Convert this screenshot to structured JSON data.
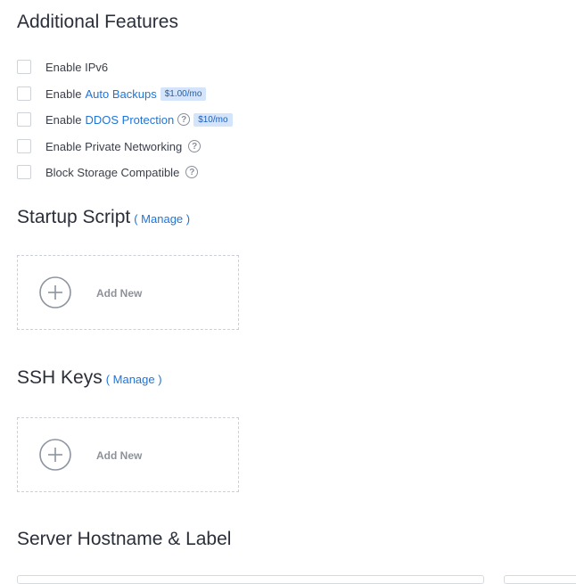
{
  "additional_features": {
    "title": "Additional Features",
    "items": [
      {
        "prefix": "Enable IPv6",
        "link": "",
        "price": "",
        "help": false
      },
      {
        "prefix": "Enable",
        "link": "Auto Backups",
        "price": "$1.00/mo",
        "help": false
      },
      {
        "prefix": "Enable",
        "link": "DDOS Protection",
        "price": "$10/mo",
        "help": true
      },
      {
        "prefix": "Enable Private Networking",
        "link": "",
        "price": "",
        "help": true
      },
      {
        "prefix": "Block Storage Compatible",
        "link": "",
        "price": "",
        "help": true
      }
    ]
  },
  "startup_script": {
    "title": "Startup Script",
    "manage_label": "( Manage )",
    "add_label": "Add New"
  },
  "ssh_keys": {
    "title": "SSH Keys",
    "manage_label": "( Manage )",
    "add_label": "Add New"
  },
  "server_hostname": {
    "title": "Server Hostname & Label"
  },
  "colors": {
    "link": "#1e74d8",
    "price_badge_bg": "#d3e4fb"
  },
  "icons": {
    "help": "question-circle-icon",
    "add": "plus-circle-icon"
  }
}
